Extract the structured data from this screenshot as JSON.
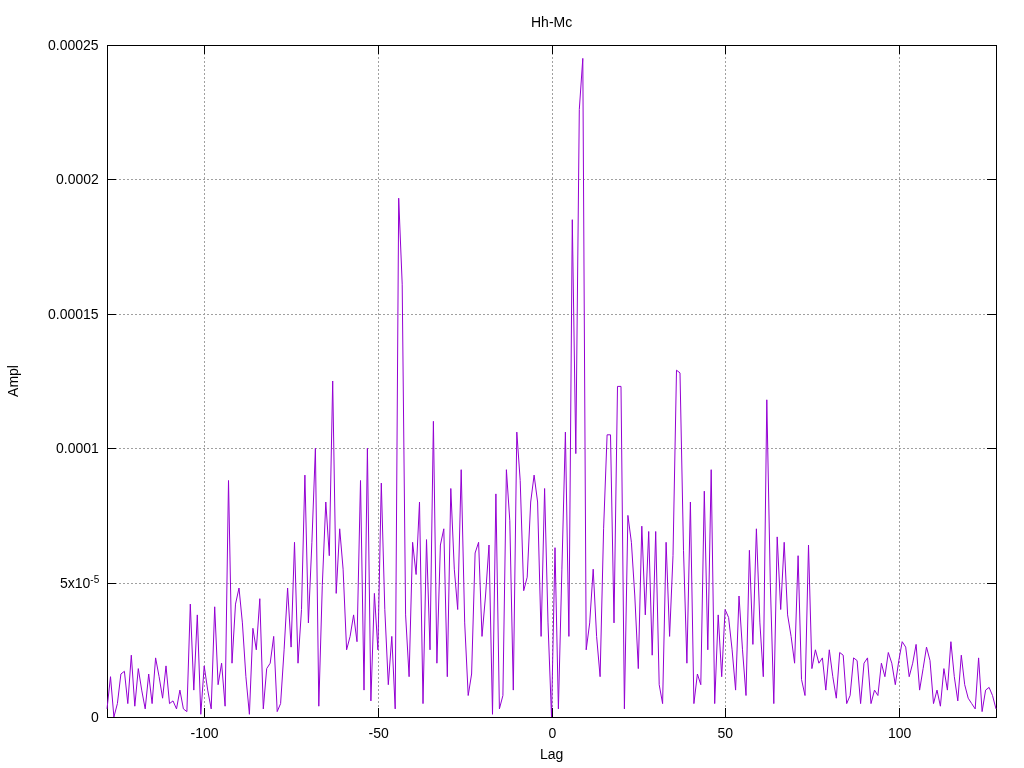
{
  "chart_data": {
    "type": "line",
    "title": "Hh-Mc",
    "xlabel": "Lag",
    "ylabel": "Ampl",
    "xlim": [
      -128,
      128
    ],
    "ylim": [
      0,
      0.00025
    ],
    "xticks": [
      -100,
      -50,
      0,
      50,
      100
    ],
    "yticks": [
      0,
      {
        "value": 5e-05,
        "label": "5x10$^{-5}$"
      },
      0.0001,
      0.00015,
      0.0002,
      0.00025
    ],
    "grid": true,
    "x": [
      -128,
      -127,
      -126,
      -125,
      -124,
      -123,
      -122,
      -121,
      -120,
      -119,
      -118,
      -117,
      -116,
      -115,
      -114,
      -113,
      -112,
      -111,
      -110,
      -109,
      -108,
      -107,
      -106,
      -105,
      -104,
      -103,
      -102,
      -101,
      -100,
      -99,
      -98,
      -97,
      -96,
      -95,
      -94,
      -93,
      -92,
      -91,
      -90,
      -89,
      -88,
      -87,
      -86,
      -85,
      -84,
      -83,
      -82,
      -81,
      -80,
      -79,
      -78,
      -77,
      -76,
      -75,
      -74,
      -73,
      -72,
      -71,
      -70,
      -69,
      -68,
      -67,
      -66,
      -65,
      -64,
      -63,
      -62,
      -61,
      -60,
      -59,
      -58,
      -57,
      -56,
      -55,
      -54,
      -53,
      -52,
      -51,
      -50,
      -49,
      -48,
      -47,
      -46,
      -45,
      -44,
      -43,
      -42,
      -41,
      -40,
      -39,
      -38,
      -37,
      -36,
      -35,
      -34,
      -33,
      -32,
      -31,
      -30,
      -29,
      -28,
      -27,
      -26,
      -25,
      -24,
      -23,
      -22,
      -21,
      -20,
      -19,
      -18,
      -17,
      -16,
      -15,
      -14,
      -13,
      -12,
      -11,
      -10,
      -9,
      -8,
      -7,
      -6,
      -5,
      -4,
      -3,
      -2,
      -1,
      0,
      1,
      2,
      3,
      4,
      5,
      6,
      7,
      8,
      9,
      10,
      11,
      12,
      13,
      14,
      15,
      16,
      17,
      18,
      19,
      20,
      21,
      22,
      23,
      24,
      25,
      26,
      27,
      28,
      29,
      30,
      31,
      32,
      33,
      34,
      35,
      36,
      37,
      38,
      39,
      40,
      41,
      42,
      43,
      44,
      45,
      46,
      47,
      48,
      49,
      50,
      51,
      52,
      53,
      54,
      55,
      56,
      57,
      58,
      59,
      60,
      61,
      62,
      63,
      64,
      65,
      66,
      67,
      68,
      69,
      70,
      71,
      72,
      73,
      74,
      75,
      76,
      77,
      78,
      79,
      80,
      81,
      82,
      83,
      84,
      85,
      86,
      87,
      88,
      89,
      90,
      91,
      92,
      93,
      94,
      95,
      96,
      97,
      98,
      99,
      100,
      101,
      102,
      103,
      104,
      105,
      106,
      107,
      108,
      109,
      110,
      111,
      112,
      113,
      114,
      115,
      116,
      117,
      118,
      119,
      120,
      121,
      122,
      123,
      124,
      125,
      126,
      127,
      128
    ],
    "series": [
      {
        "color": "#9400d3",
        "values": [
          3e-06,
          1.5e-05,
          0,
          5e-06,
          1.6e-05,
          1.7e-05,
          5e-06,
          2.3e-05,
          4e-06,
          1.8e-05,
          1e-05,
          3e-06,
          1.6e-05,
          5e-06,
          2.2e-05,
          1.5e-05,
          7e-06,
          1.9e-05,
          5e-06,
          6e-06,
          3e-06,
          1e-05,
          3e-06,
          2e-06,
          4.2e-05,
          1e-05,
          3.8e-05,
          1e-06,
          1.9e-05,
          1e-05,
          3e-06,
          4.1e-05,
          1.2e-05,
          2e-05,
          4e-06,
          8.8e-05,
          2e-05,
          4.2e-05,
          4.8e-05,
          3.5e-05,
          1.5e-05,
          1e-06,
          3.3e-05,
          2.5e-05,
          4.4e-05,
          3e-06,
          1.8e-05,
          2e-05,
          3e-05,
          2e-06,
          5e-06,
          2.5e-05,
          4.8e-05,
          2.6e-05,
          6.5e-05,
          2e-05,
          4e-05,
          9e-05,
          3.5e-05,
          6.5e-05,
          0.0001,
          4e-06,
          4.9e-05,
          8e-05,
          6e-05,
          0.000125,
          4.6e-05,
          7e-05,
          5.5e-05,
          2.5e-05,
          3e-05,
          3.8e-05,
          2.8e-05,
          8.8e-05,
          1e-05,
          0.0001,
          6e-06,
          4.6e-05,
          2.5e-05,
          8.7e-05,
          4e-05,
          1.2e-05,
          3e-05,
          3e-06,
          0.000193,
          0.000161,
          3.8e-05,
          1.5e-05,
          6.5e-05,
          5.3e-05,
          8e-05,
          5e-06,
          6.6e-05,
          2.5e-05,
          0.00011,
          2e-05,
          6.4e-05,
          7e-05,
          1.5e-05,
          8.5e-05,
          5.5e-05,
          4e-05,
          9.2e-05,
          3.5e-05,
          8e-06,
          1.6e-05,
          6.1e-05,
          6.5e-05,
          3e-05,
          4.5e-05,
          6.4e-05,
          1e-06,
          8.3e-05,
          3e-06,
          8e-06,
          9.2e-05,
          7.3e-05,
          1e-05,
          0.000106,
          8.8e-05,
          4.7e-05,
          5.2e-05,
          8e-05,
          9e-05,
          8e-05,
          3e-05,
          8.5e-05,
          3.5e-05,
          0,
          6.3e-05,
          3e-06,
          5.5e-05,
          0.000106,
          3e-05,
          0.000185,
          9.8e-05,
          0.000226,
          0.000245,
          2.5e-05,
          3.5e-05,
          5.5e-05,
          3e-05,
          1.5e-05,
          7e-05,
          0.000105,
          0.000105,
          3.5e-05,
          0.000123,
          0.000123,
          3e-06,
          7.5e-05,
          6.5e-05,
          4.5e-05,
          1.8e-05,
          7.1e-05,
          3.8e-05,
          6.9e-05,
          2.3e-05,
          6.9e-05,
          1.2e-05,
          5e-06,
          6.5e-05,
          3e-05,
          6e-05,
          0.000129,
          0.000128,
          6.2e-05,
          2e-05,
          8e-05,
          5e-06,
          1.6e-05,
          1.2e-05,
          8.4e-05,
          2.5e-05,
          9.2e-05,
          5e-06,
          3.8e-05,
          1.5e-05,
          4e-05,
          3.7e-05,
          2.5e-05,
          1e-05,
          4.5e-05,
          2.5e-05,
          8e-06,
          6.2e-05,
          2.7e-05,
          7e-05,
          3.5e-05,
          1.5e-05,
          0.000118,
          5e-05,
          5e-06,
          6.7e-05,
          4e-05,
          6.5e-05,
          3.8e-05,
          3e-05,
          2e-05,
          6e-05,
          1.4e-05,
          8e-06,
          6.4e-05,
          1.8e-05,
          2.5e-05,
          2e-05,
          2.2e-05,
          1e-05,
          2.5e-05,
          1.5e-05,
          7e-06,
          2.4e-05,
          2.3e-05,
          5e-06,
          8e-06,
          2.2e-05,
          2.1e-05,
          5e-06,
          2e-05,
          2.2e-05,
          5e-06,
          1e-05,
          8e-06,
          2e-05,
          1.5e-05,
          2.4e-05,
          2e-05,
          1.2e-05,
          2.1e-05,
          2.8e-05,
          2.6e-05,
          1.5e-05,
          2e-05,
          2.7e-05,
          1e-05,
          1.8e-05,
          2.6e-05,
          2.1e-05,
          5e-06,
          1e-05,
          4e-06,
          1.8e-05,
          1e-05,
          2.8e-05,
          1.5e-05,
          6e-06,
          2.3e-05,
          1.2e-05,
          7e-06,
          5e-06,
          3e-06,
          2.2e-05,
          2e-06,
          1e-05,
          1.1e-05,
          8e-06,
          3e-06
        ]
      }
    ]
  }
}
